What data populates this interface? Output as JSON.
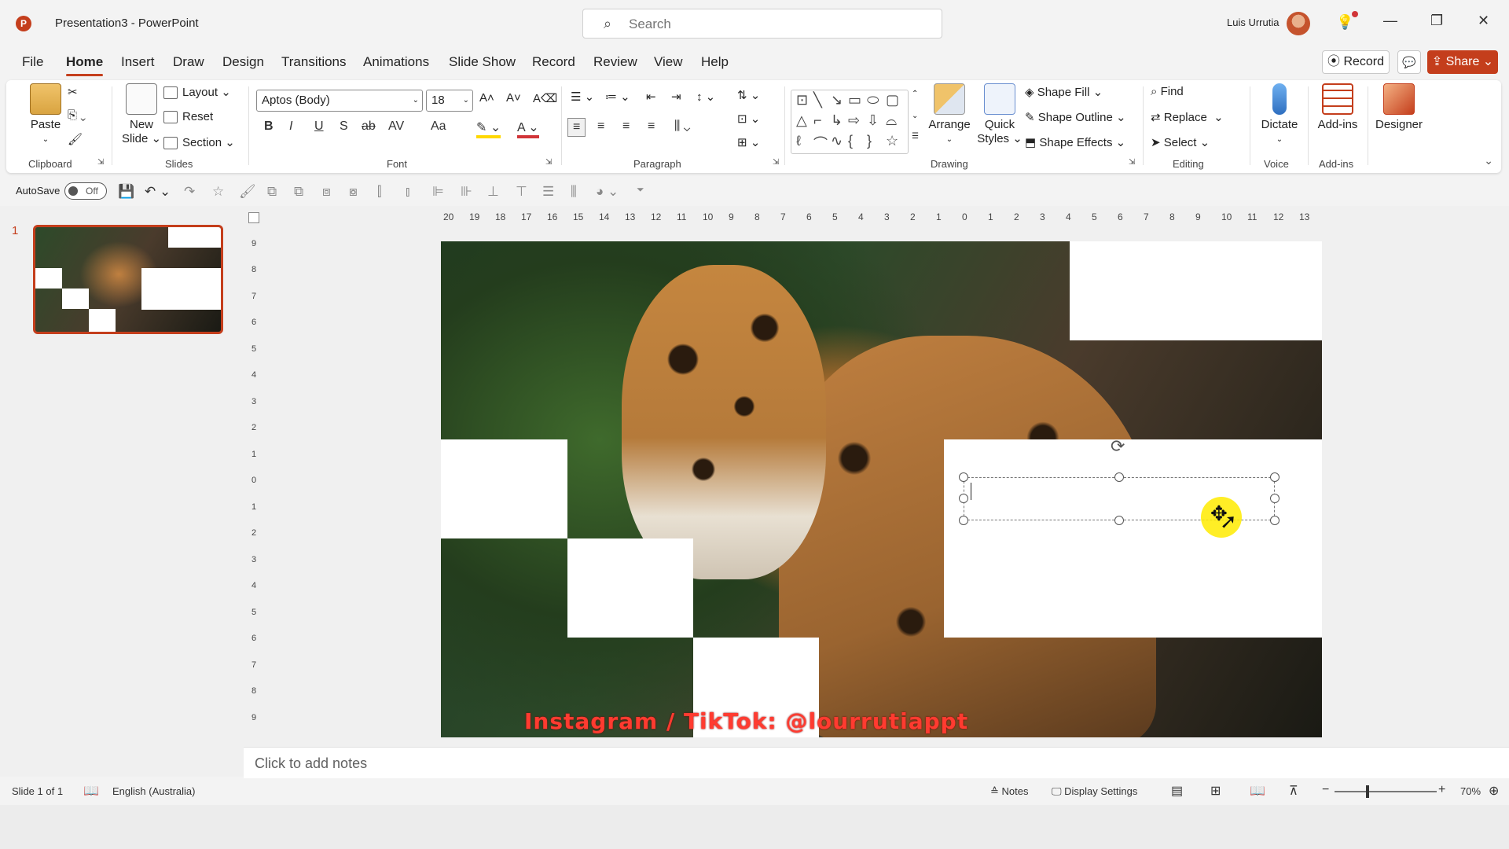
{
  "titlebar": {
    "app_icon": "P",
    "doc_title": "Presentation3  -  PowerPoint",
    "search_placeholder": "Search",
    "user_name": "Luis Urrutia",
    "minimize": "—",
    "restore": "❐",
    "close": "✕"
  },
  "menu": {
    "tabs": [
      "File",
      "Home",
      "Insert",
      "Draw",
      "Design",
      "Transitions",
      "Animations",
      "Slide Show",
      "Record",
      "Review",
      "View",
      "Help"
    ],
    "active_tab": "Home",
    "record_label": "Record",
    "share_label": "Share"
  },
  "ribbon": {
    "clipboard": {
      "paste": "Paste",
      "label": "Clipboard"
    },
    "slides": {
      "new_slide_1": "New",
      "new_slide_2": "Slide",
      "layout": "Layout",
      "reset": "Reset",
      "section": "Section",
      "label": "Slides"
    },
    "font": {
      "font_name": "Aptos (Body)",
      "font_size": "18",
      "label": "Font",
      "bold": "B",
      "italic": "I",
      "underline": "U",
      "shadow": "S",
      "strike": "ab",
      "spacing": "AV",
      "case": "Aa",
      "grow": "A˄",
      "shrink": "A˅"
    },
    "paragraph": {
      "label": "Paragraph"
    },
    "drawing": {
      "arrange": "Arrange",
      "quick_styles_1": "Quick",
      "quick_styles_2": "Styles",
      "shape_fill": "Shape Fill",
      "shape_outline": "Shape Outline",
      "shape_effects": "Shape Effects",
      "label": "Drawing"
    },
    "editing": {
      "find": "Find",
      "replace": "Replace",
      "select": "Select",
      "label": "Editing"
    },
    "voice": {
      "dictate": "Dictate",
      "label": "Voice"
    },
    "addins": {
      "addins": "Add-ins",
      "label": "Add-ins"
    },
    "designer": {
      "designer": "Designer"
    }
  },
  "qat": {
    "autosave_label": "AutoSave",
    "toggle_state": "Off"
  },
  "thumbnail": {
    "number": "1"
  },
  "ruler": {
    "h_ticks": [
      "20",
      "19",
      "18",
      "17",
      "16",
      "15",
      "14",
      "13",
      "12",
      "11",
      "10",
      "9",
      "8",
      "7",
      "6",
      "5",
      "4",
      "3",
      "2",
      "1",
      "0",
      "1",
      "2",
      "3",
      "4",
      "5",
      "6",
      "7",
      "8",
      "9",
      "10",
      "11",
      "12",
      "13"
    ],
    "v_ticks": [
      "9",
      "8",
      "7",
      "6",
      "5",
      "4",
      "3",
      "2",
      "1",
      "0",
      "1",
      "2",
      "3",
      "4",
      "5",
      "6",
      "7",
      "8",
      "9"
    ]
  },
  "slide": {
    "watermark": "Instagram / TikTok: @lourrutiappt"
  },
  "notes": {
    "placeholder": "Click to add notes"
  },
  "statusbar": {
    "slide_info": "Slide 1 of 1",
    "language": "English (Australia)",
    "notes": "Notes",
    "display_settings": "Display Settings",
    "zoom_minus": "−",
    "zoom_plus": "+",
    "zoom": "70%"
  },
  "colors": {
    "accent": "#c43e1c",
    "watermark": "#ff3b30"
  }
}
